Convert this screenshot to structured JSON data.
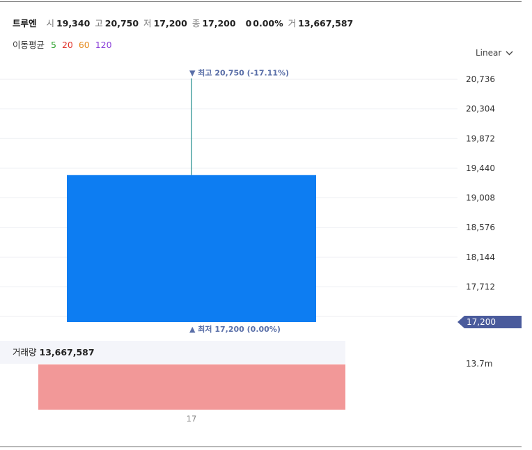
{
  "header": {
    "name": "트루엔",
    "open_label": "시",
    "open": "19,340",
    "high_label": "고",
    "high": "20,750",
    "low_label": "저",
    "low": "17,200",
    "close_label": "종",
    "close": "17,200",
    "change": "0",
    "change_pct": "0.00%",
    "volume_label": "거",
    "volume": "13,667,587"
  },
  "ma": {
    "label": "이동평균",
    "periods": [
      {
        "text": "5",
        "color": "#2aa12a"
      },
      {
        "text": "20",
        "color": "#e0342c"
      },
      {
        "text": "60",
        "color": "#e58a1c"
      },
      {
        "text": "120",
        "color": "#8a3fd9"
      }
    ]
  },
  "scale_selector": {
    "label": "Linear",
    "icon": "chevron-down-icon"
  },
  "volume_panel": {
    "label": "거래량",
    "value": "13,667,587"
  },
  "chart_data": {
    "type": "candlestick",
    "x": [
      "17"
    ],
    "candles": [
      {
        "x": "17",
        "open": 19340,
        "high": 20750,
        "low": 17200,
        "close": 17200
      }
    ],
    "y_ticks": [
      "20,736",
      "20,304",
      "19,872",
      "19,440",
      "19,008",
      "18,576",
      "18,144",
      "17,712"
    ],
    "ylim": [
      17200,
      20736
    ],
    "y_scale": "linear",
    "current_price_label": "17,200",
    "high_annotation": {
      "label": "최고",
      "value": "20,750",
      "pct": "(-17.11%)"
    },
    "low_annotation": {
      "label": "최저",
      "value": "17,200",
      "pct": "(0.00%)"
    },
    "volume": {
      "values": [
        13667587
      ],
      "axis_label": "13.7m"
    },
    "colors": {
      "down_candle": "#0d7df2",
      "wick": "#1c8a8a",
      "volume_bar": "#f29898",
      "price_tag": "#4a5b9c",
      "annotation": "#5a6fa8"
    }
  }
}
